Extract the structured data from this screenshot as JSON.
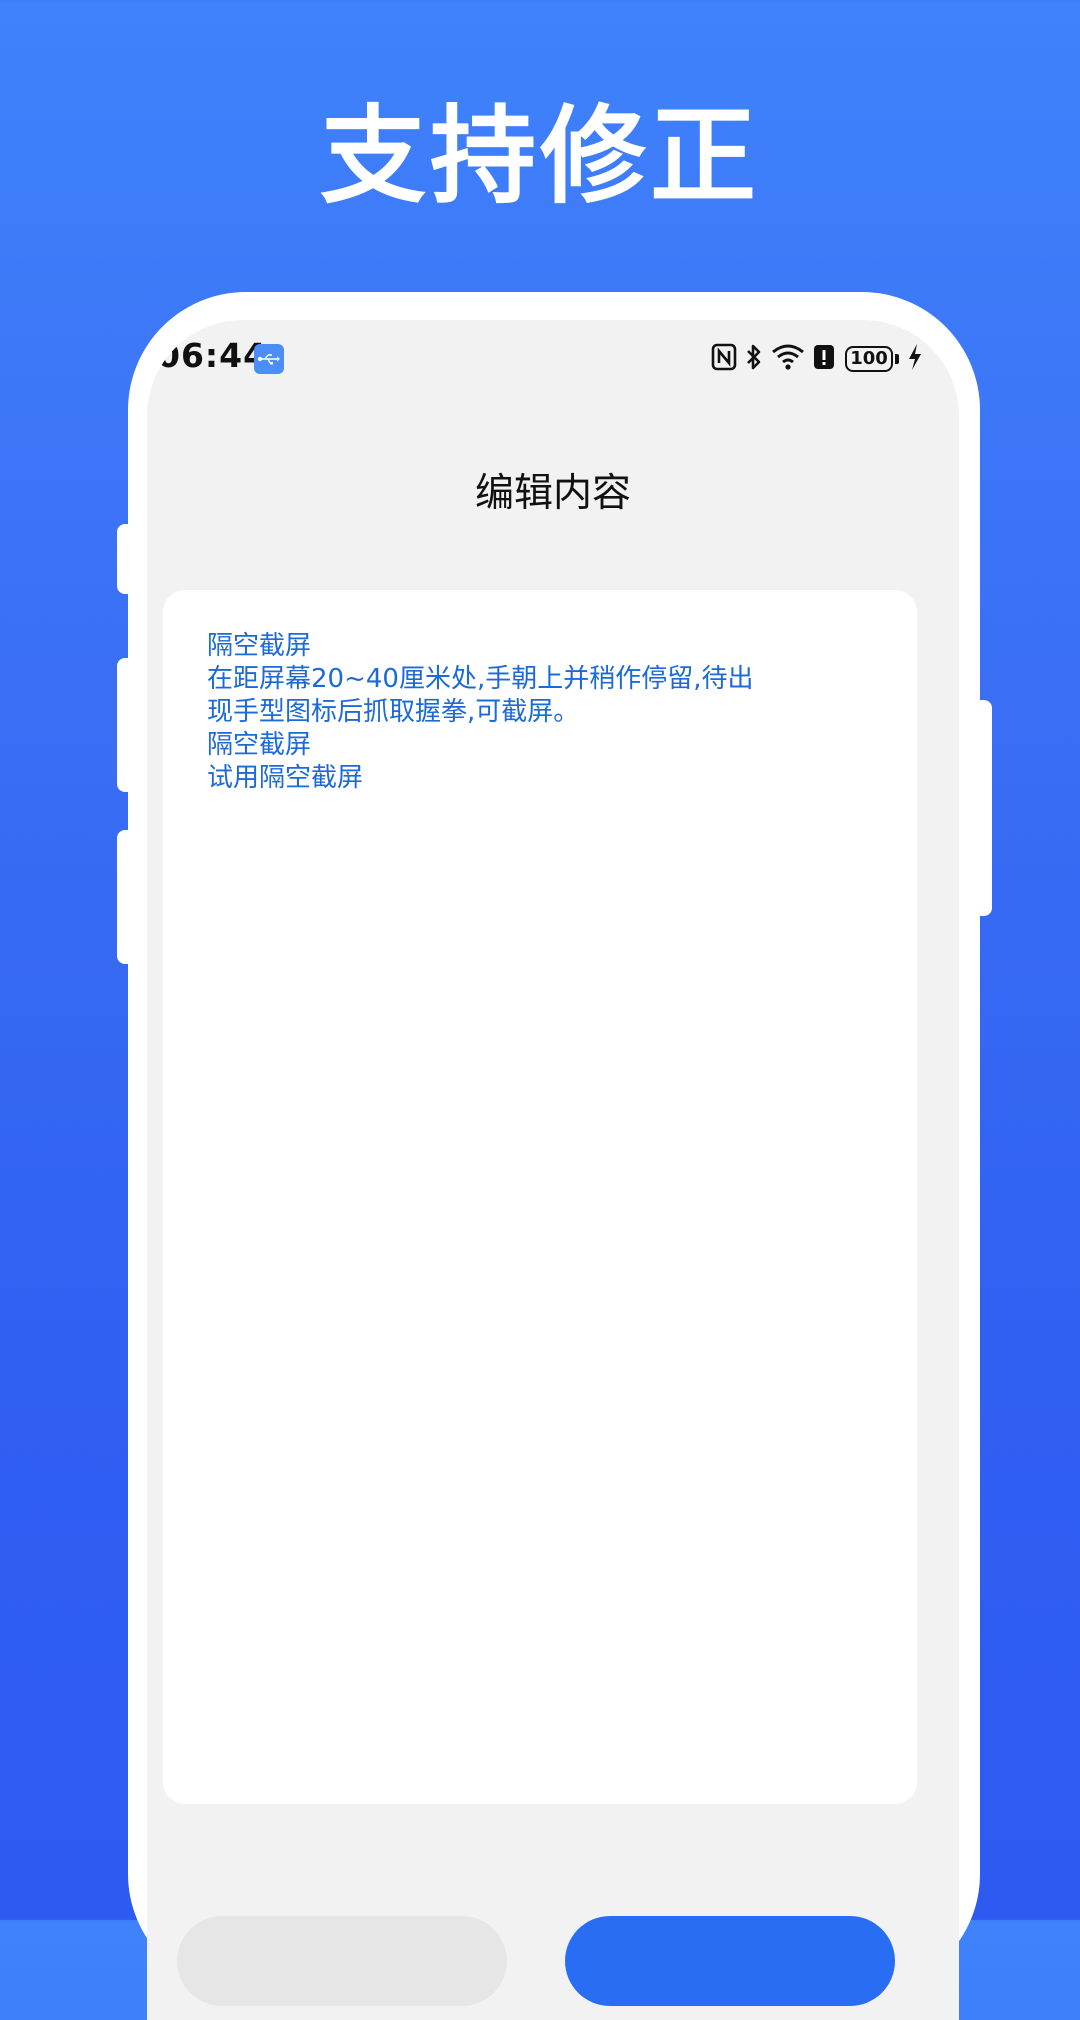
{
  "promo": {
    "headline": "支持修正"
  },
  "status_bar": {
    "time": "06:44",
    "battery_level": "100",
    "icons": [
      "usb-icon",
      "nfc-icon",
      "bluetooth-icon",
      "wifi-icon",
      "alert-icon",
      "battery-icon",
      "charging-icon"
    ]
  },
  "header": {
    "title": "编辑内容"
  },
  "editor": {
    "lines": [
      "隔空截屏",
      "在距屏幕20~40厘米处,手朝上并稍作停留,待出",
      "现手型图标后抓取握拳,可截屏。",
      "隔空截屏",
      "试用隔空截屏"
    ]
  },
  "colors": {
    "background_top": "#3f82fb",
    "background_bottom": "#2d5af0",
    "text_accent": "#1c6ad8",
    "primary_button": "#2a6df5"
  }
}
